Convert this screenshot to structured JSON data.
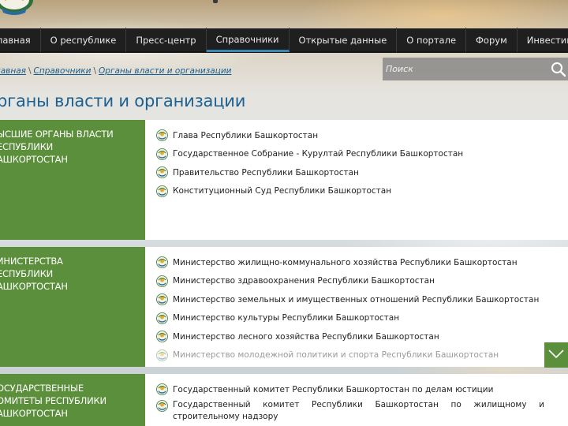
{
  "nav": {
    "items": [
      "лавная",
      "О республике",
      "Пресс-центр",
      "Справочники",
      "Открытые данные",
      "О портале",
      "Форум",
      "Инвестиции"
    ],
    "active_index": 3
  },
  "breadcrumb": {
    "items": [
      "лавная",
      "Справочники",
      "Органы власти и организации"
    ]
  },
  "search": {
    "placeholder": "Поиск"
  },
  "page_title": "рганы власти и организации",
  "sections": [
    {
      "heading": "ЫСШИЕ ОРГАНЫ ВЛАСТИ\nЕСПУБЛИКИ\nАШКОРТОСТАН",
      "items": [
        "Глава Республики Башкортостан",
        "Государственное Собрание - Курултай Республики Башкортостан",
        "Правительство Республики Башкортостан",
        "Конституционный Суд Республики Башкортостан"
      ]
    },
    {
      "heading": "ИНИСТЕРСТВА\nЕСПУБЛИКИ\nАШКОРТОСТАН",
      "items": [
        "Министерство жилищно-коммунального хозяйства Республики Башкортостан",
        "Министерство здравоохранения Республики Башкортостан",
        "Министерство земельных и имущественных отношений Республики Башкортостан",
        "Министерство культуры Республики Башкортостан",
        "Министерство лесного хозяйства Республики Башкортостан",
        "Министерство молодежной политики и спорта Республики Башкортостан"
      ]
    },
    {
      "heading": "ОСУДАРСТВЕННЫЕ\nОМИТЕТЫ РЕСПУБЛИКИ\nАШКОРТОСТАН",
      "items": [
        "Государственный комитет Республики Башкортостан по делам юстиции",
        "Государственный комитет Республики Башкортостан по жилищному и строительному надзору"
      ]
    }
  ],
  "colors": {
    "nav_bg": "#1f1f1f",
    "accent_blue": "#1c6191",
    "section_green": "#5b8f3b",
    "active_underline": "#3a86b3"
  },
  "icons": [
    "republic-emblem-icon",
    "search-icon",
    "chevron-down-icon"
  ]
}
